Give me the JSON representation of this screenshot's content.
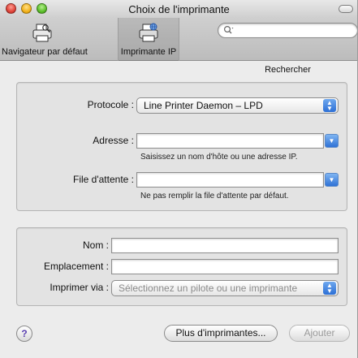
{
  "window": {
    "title": "Choix de l'imprimante"
  },
  "toolbar": {
    "default_browser_label": "Navigateur par défaut",
    "ip_printer_label": "Imprimante IP",
    "search_placeholder": "",
    "search_label": "Rechercher"
  },
  "ip_form": {
    "protocol_label": "Protocole :",
    "protocol_value": "Line Printer Daemon – LPD",
    "address_label": "Adresse :",
    "address_value": "",
    "address_hint": "Saisissez un nom d'hôte ou une adresse IP.",
    "queue_label": "File d'attente :",
    "queue_value": "",
    "queue_hint": "Ne pas remplir la file d'attente par défaut."
  },
  "printer_info": {
    "name_label": "Nom :",
    "name_value": "",
    "location_label": "Emplacement :",
    "location_value": "",
    "print_using_label": "Imprimer via :",
    "print_using_value": "Sélectionnez un pilote ou une imprimante"
  },
  "footer": {
    "help_glyph": "?",
    "more_printers_label": "Plus d'imprimantes...",
    "add_label": "Ajouter"
  },
  "icons": [
    "default-printer-icon",
    "ip-printer-icon",
    "search-icon",
    "popup-arrows-icon",
    "combo-arrow-icon",
    "help-icon"
  ],
  "colors": {
    "accent": "#2c6fd6",
    "disabled_text": "#9a9a9a"
  }
}
